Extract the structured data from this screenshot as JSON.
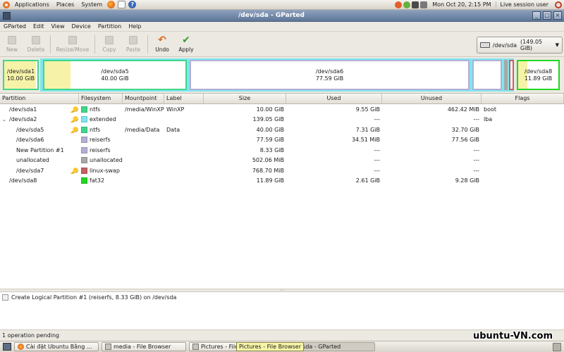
{
  "top_panel": {
    "menus": [
      "Applications",
      "Places",
      "System"
    ],
    "clock": "Mon Oct 20,  2:15 PM",
    "session": "Live session user"
  },
  "window": {
    "title": "/dev/sda - GParted"
  },
  "menubar": [
    "GParted",
    "Edit",
    "View",
    "Device",
    "Partition",
    "Help"
  ],
  "toolbar": {
    "new": "New",
    "delete": "Delete",
    "resize_move": "Resize/Move",
    "copy": "Copy",
    "paste": "Paste",
    "undo": "Undo",
    "apply": "Apply"
  },
  "device_selector": {
    "label": "/dev/sda",
    "size": "(149.05 GiB)"
  },
  "partition_map": {
    "sda1": {
      "name": "/dev/sda1",
      "size": "10.00 GiB",
      "used_fraction": 0.955
    },
    "sda5": {
      "name": "/dev/sda5",
      "size": "40.00 GiB",
      "used_fraction": 0.183
    },
    "sda6": {
      "name": "/dev/sda6",
      "size": "77.59 GiB",
      "used_fraction": 0.0
    },
    "sda8": {
      "name": "/dev/sda8",
      "size": "11.89 GiB",
      "used_fraction": 0.22
    }
  },
  "table": {
    "columns": [
      "Partition",
      "Filesystem",
      "Mountpoint",
      "Label",
      "Size",
      "Used",
      "Unused",
      "Flags"
    ],
    "rows": [
      {
        "partition": "/dev/sda1",
        "filesystem": "ntfs",
        "fs_color": "#42d68b",
        "mountpoint": "/media/WinXP",
        "label": "WinXP",
        "size": "10.00 GiB",
        "used": "9.55 GiB",
        "unused": "462.42 MiB",
        "flags": "boot",
        "key": true,
        "indent": 0,
        "expander": ""
      },
      {
        "partition": "/dev/sda2",
        "filesystem": "extended",
        "fs_color": "#7ee6ef",
        "mountpoint": "",
        "label": "",
        "size": "139.05 GiB",
        "used": "---",
        "unused": "---",
        "flags": "lba",
        "key": true,
        "indent": 0,
        "expander": "v"
      },
      {
        "partition": "/dev/sda5",
        "filesystem": "ntfs",
        "fs_color": "#42d68b",
        "mountpoint": "/media/Data",
        "label": "Data",
        "size": "40.00 GiB",
        "used": "7.31 GiB",
        "unused": "32.70 GiB",
        "flags": "",
        "key": true,
        "indent": 1,
        "expander": ""
      },
      {
        "partition": "/dev/sda6",
        "filesystem": "reiserfs",
        "fs_color": "#b4aed6",
        "mountpoint": "",
        "label": "",
        "size": "77.59 GiB",
        "used": "34.51 MiB",
        "unused": "77.56 GiB",
        "flags": "",
        "key": false,
        "indent": 1,
        "expander": ""
      },
      {
        "partition": "New Partition #1",
        "filesystem": "reiserfs",
        "fs_color": "#b4aed6",
        "mountpoint": "",
        "label": "",
        "size": "8.33 GiB",
        "used": "---",
        "unused": "---",
        "flags": "",
        "key": false,
        "indent": 1,
        "expander": ""
      },
      {
        "partition": "unallocated",
        "filesystem": "unallocated",
        "fs_color": "#a8a8a8",
        "mountpoint": "",
        "label": "",
        "size": "502.06 MiB",
        "used": "---",
        "unused": "---",
        "flags": "",
        "key": false,
        "indent": 1,
        "expander": ""
      },
      {
        "partition": "/dev/sda7",
        "filesystem": "linux-swap",
        "fs_color": "#c66060",
        "mountpoint": "",
        "label": "",
        "size": "768.70 MiB",
        "used": "---",
        "unused": "---",
        "flags": "",
        "key": true,
        "indent": 1,
        "expander": ""
      },
      {
        "partition": "/dev/sda8",
        "filesystem": "fat32",
        "fs_color": "#22d622",
        "mountpoint": "",
        "label": "",
        "size": "11.89 GiB",
        "used": "2.61 GiB",
        "unused": "9.28 GiB",
        "flags": "",
        "key": false,
        "indent": 0,
        "expander": ""
      }
    ]
  },
  "operations": [
    "Create Logical Partition #1 (reiserfs, 8.33 GiB) on /dev/sda"
  ],
  "status": "1 operation pending",
  "watermark": "ubuntu-VN.com",
  "taskbar": {
    "tasks": [
      "Cài đặt Ubuntu Bằng ...",
      "media - File Browser",
      "Pictures - File Browser",
      "/dev/sda - GParted"
    ],
    "tooltip": "Pictures - File Browser"
  }
}
